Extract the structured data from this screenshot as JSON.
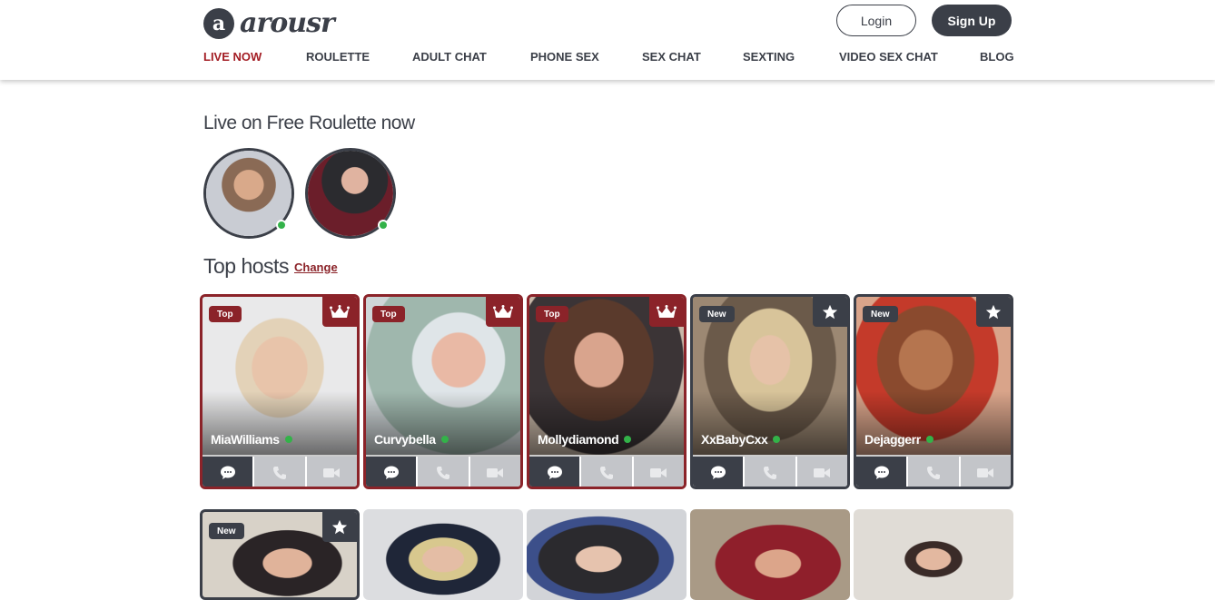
{
  "brand": {
    "badge": "a",
    "name": "arousr"
  },
  "auth": {
    "login_label": "Login",
    "signup_label": "Sign Up"
  },
  "nav": [
    {
      "label": "LIVE NOW",
      "active": true
    },
    {
      "label": "ROULETTE"
    },
    {
      "label": "ADULT CHAT"
    },
    {
      "label": "PHONE SEX"
    },
    {
      "label": "SEX CHAT"
    },
    {
      "label": "SEXTING"
    },
    {
      "label": "VIDEO SEX CHAT"
    },
    {
      "label": "BLOG"
    }
  ],
  "roulette": {
    "title": "Live on Free Roulette now",
    "avatars": [
      {
        "online": true
      },
      {
        "online": true
      }
    ]
  },
  "top_hosts": {
    "title": "Top hosts",
    "change_label": "Change",
    "cards": [
      {
        "name": "MiaWilliams",
        "badge": "Top",
        "icon": "crown-icon",
        "online": true
      },
      {
        "name": "Curvybella",
        "badge": "Top",
        "icon": "crown-icon",
        "online": true
      },
      {
        "name": "Mollydiamond",
        "badge": "Top",
        "icon": "crown-icon",
        "online": true
      },
      {
        "name": "XxBabyCxx",
        "badge": "New",
        "icon": "star-icon",
        "online": true
      },
      {
        "name": "Dejaggerr",
        "badge": "New",
        "icon": "star-icon",
        "online": true
      }
    ],
    "action_icons": [
      "chat-bubble-icon",
      "phone-icon",
      "video-camera-icon"
    ]
  },
  "second_row": [
    {
      "badge": "New",
      "icon": "star-icon"
    },
    {},
    {},
    {},
    {}
  ],
  "colors": {
    "dark": "#3b3f48",
    "accent_red": "#a31d24",
    "top_border": "#8b2329",
    "online": "#33b249"
  }
}
